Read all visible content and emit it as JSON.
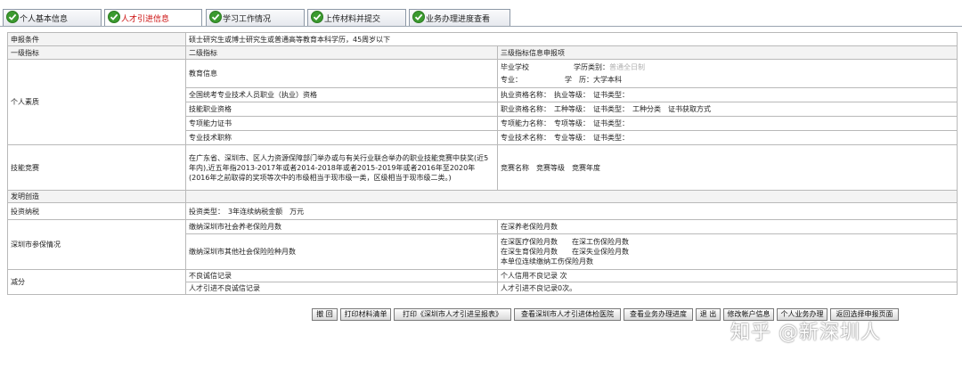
{
  "tabs": [
    {
      "label": "个人基本信息",
      "active": false
    },
    {
      "label": "人才引进信息",
      "active": true
    },
    {
      "label": "学习工作情况",
      "active": false
    },
    {
      "label": "上传材料并提交",
      "active": false
    },
    {
      "label": "业务办理进度查看",
      "active": false
    }
  ],
  "form": {
    "apply_condition_label": "申报条件",
    "apply_condition_value": "硕士研究生或博士研究生或普通高等教育本科学历，45周岁以下",
    "col_level1": "一级指标",
    "col_level2": "二级指标",
    "col_level3": "三级指标信息申报项",
    "personal_quality": "个人素质",
    "education_info": "教育信息",
    "grad_school": "毕业学校",
    "edu_category": "学历类别：",
    "edu_category_value": "普通全日制",
    "major": "专业：",
    "degree": "学　历：大学本科",
    "qual_national": "全国统考专业技术人员职业（执业）资格",
    "qual_national_detail": "执业资格名称：　执业等级：　证书类型：",
    "qual_skill": "技能职业资格",
    "qual_skill_detail": "职业资格名称：　工种等级：　证书类型：　工种分类　证书获取方式",
    "qual_special": "专项能力证书",
    "qual_special_detail": "专项能力名称：　专项等级：　证书类型：",
    "qual_tech": "专业技术职称",
    "qual_tech_detail": "专业技术名称：　专业等级：　证书类型：",
    "skill_contest": "技能竞赛",
    "skill_contest_desc": "在广东省、深圳市、区人力资源保障部门举办或与有关行业联合举办的职业技能竞赛中获奖(近5年内),近五年指2013-2017年或者2014-2018年或者2015-2019年或者2016年至2020年(2016年之前取得的奖项等次中的市级相当于现市级一类，区级相当于现市级二类。)",
    "skill_contest_detail": "竞赛名称　竞赛等级　竞赛年度",
    "invention": "发明创造",
    "investment": "投资纳税",
    "investment_detail": "投资类型：　3年连续纳税金额　万元",
    "insurance": "深圳市参保情况",
    "pension_months": "缴纳深圳市社会养老保险月数",
    "pension_detail": "在深养老保险月数",
    "other_insurance": "缴纳深圳市其他社会保险险种月数",
    "other_detail_lines": [
      "在深医疗保险月数　　在深工伤保险月数",
      "在深生育保险月数　　在深失业保险月数",
      "本单位连续缴纳工伤保险月数"
    ],
    "deduction": "减分",
    "bad_credit": "不良诚信记录",
    "bad_credit_detail": "个人信用不良记录 次",
    "talent_bad_credit": "人才引进不良诚信记录",
    "talent_bad_credit_detail": "人才引进不良记录0次。"
  },
  "buttons": [
    "撤 回",
    "打印材料清单",
    "打印《深圳市人才引进呈报表》",
    "查看深圳市人才引进体检医院",
    "查看业务办理进度",
    "退 出",
    "修改帐户信息",
    "个人业务办理",
    "返回选择申报页面"
  ],
  "watermark": "知乎 @新深圳人",
  "colors": {
    "tab_active_text": "#cc1111",
    "check_green": "#3b9a2f"
  }
}
